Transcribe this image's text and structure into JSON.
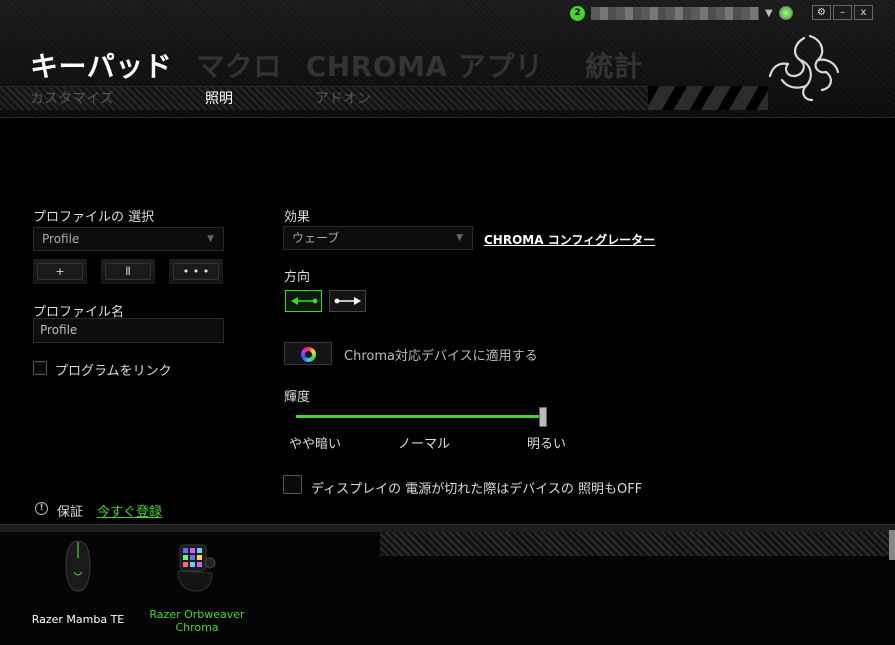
{
  "header": {
    "notification_count": "2",
    "tabs": [
      {
        "label": "キーパッド",
        "active": true
      },
      {
        "label": "マクロ",
        "active": false
      },
      {
        "label": "CHROMA アプリ",
        "active": false
      },
      {
        "label": "統計",
        "active": false
      }
    ],
    "subtabs": [
      {
        "label": "カスタマイズ",
        "active": false
      },
      {
        "label": "照明",
        "active": true
      },
      {
        "label": "アドオン",
        "active": false
      }
    ],
    "window_buttons": {
      "settings": "⚙",
      "minimize": "–",
      "close": "x"
    }
  },
  "profile": {
    "select_label": "プロファイルの 選択",
    "selected": "Profile",
    "add_button": "+",
    "copy_button": "⫴",
    "more_button": "• • •",
    "name_label": "プロファイル名",
    "name_value": "Profile",
    "link_program_label": "プログラムをリンク",
    "link_program_checked": false
  },
  "lighting": {
    "effect_label": "効果",
    "effect_value": "ウェーブ",
    "configurator_link": "CHROMA コンフィグレーター",
    "direction_label": "方向",
    "direction_selected": "left",
    "apply_chroma_label": "Chroma対応デバイスに適用する",
    "brightness_label": "輝度",
    "brightness_value": 1.0,
    "brightness_low": "やや暗い",
    "brightness_mid": "ノーマル",
    "brightness_high": "明るい",
    "display_off_label": "ディスプレイの 電源が切れた際はデバイスの 照明もOFF",
    "display_off_checked": false
  },
  "warranty": {
    "label": "保証",
    "register_link": "今すぐ登録"
  },
  "devices": [
    {
      "name": "Razer Mamba TE",
      "selected": false
    },
    {
      "name": "Razer Orbweaver\nChroma",
      "selected": true
    }
  ],
  "colors": {
    "accent": "#44d62c",
    "background": "#000000"
  }
}
